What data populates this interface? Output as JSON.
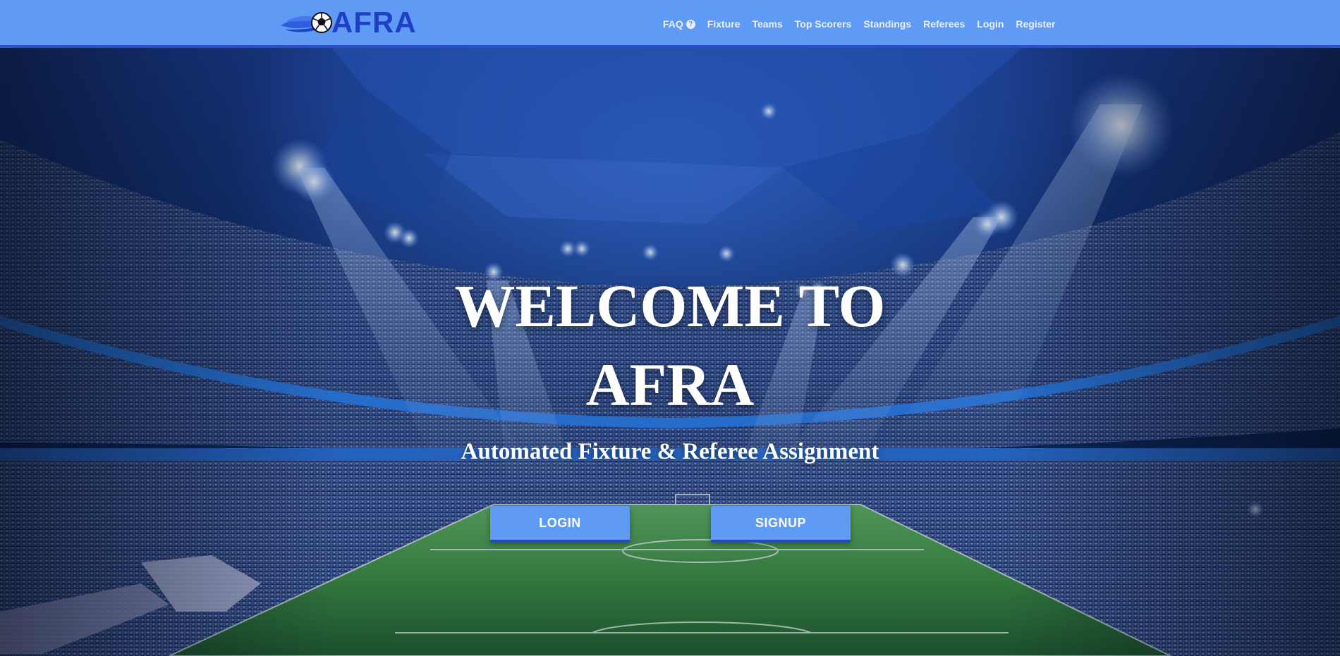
{
  "brand": {
    "name": "AFRA",
    "logo_icon": "soccer-ball-flame-icon"
  },
  "nav": {
    "items": [
      {
        "label": "FAQ",
        "icon": "question-circle-icon"
      },
      {
        "label": "Fixture"
      },
      {
        "label": "Teams"
      },
      {
        "label": "Top Scorers"
      },
      {
        "label": "Standings"
      },
      {
        "label": "Referees"
      },
      {
        "label": "Login"
      },
      {
        "label": "Register"
      }
    ]
  },
  "hero": {
    "title": "WELCOME TO AFRA",
    "subtitle": "Automated Fixture & Referee Assignment",
    "login_label": "LOGIN",
    "signup_label": "SIGNUP",
    "background": "stadium-night-image"
  },
  "colors": {
    "navbar": "#5f9af5",
    "navbar_border": "#2c4fc7",
    "brand_text": "#1f3fc7",
    "button": "#5f9af5",
    "button_border": "#2348c8"
  }
}
